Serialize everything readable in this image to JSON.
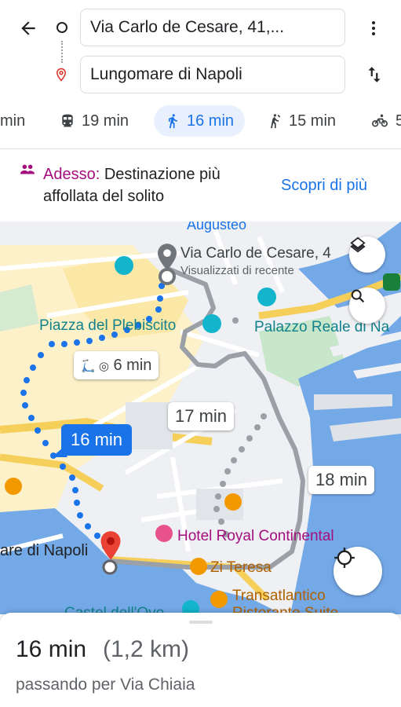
{
  "header": {
    "origin": "Via Carlo de Cesare, 41,...",
    "destination": "Lungomare di Napoli"
  },
  "modes": [
    {
      "label": "min",
      "icon": "car-icon"
    },
    {
      "label": "19 min",
      "icon": "transit-icon"
    },
    {
      "label": "16 min",
      "icon": "walk-icon",
      "active": true
    },
    {
      "label": "15 min",
      "icon": "ride-hailing-icon"
    },
    {
      "label": "5",
      "icon": "bike-icon"
    }
  ],
  "banner": {
    "highlight": "Adesso:",
    "text": " Destinazione più affollata del solito",
    "link": "Scopri di più"
  },
  "map": {
    "labels": {
      "augusteo": "Augusteo",
      "origin_name": "Via Carlo de Cesare, 4",
      "origin_sub": "Visualizzati di recente",
      "plebiscito": "Piazza del Plebiscito",
      "palazzo": "Palazzo Reale di Na",
      "hotel": "Hotel Royal Continental",
      "zi_teresa": "Zi Teresa",
      "transatlantico": "Transatlantico",
      "ristorante": "Ristorante Suite",
      "castel": "Castel dell'Ovo",
      "dest": "are di Napoli"
    },
    "bubbles": {
      "scooter": "6 min",
      "alt1": "17 min",
      "alt2": "18 min",
      "selected": "16 min"
    }
  },
  "summary": {
    "time": "16 min",
    "distance": "(1,2 km)",
    "via": "passando per Via Chiaia"
  },
  "colors": {
    "accent": "#1a73e8",
    "route_alt": "#9aa0a6",
    "water": "#74a9e8",
    "poi": "#a50e7e",
    "pin_red": "#ea4335"
  }
}
